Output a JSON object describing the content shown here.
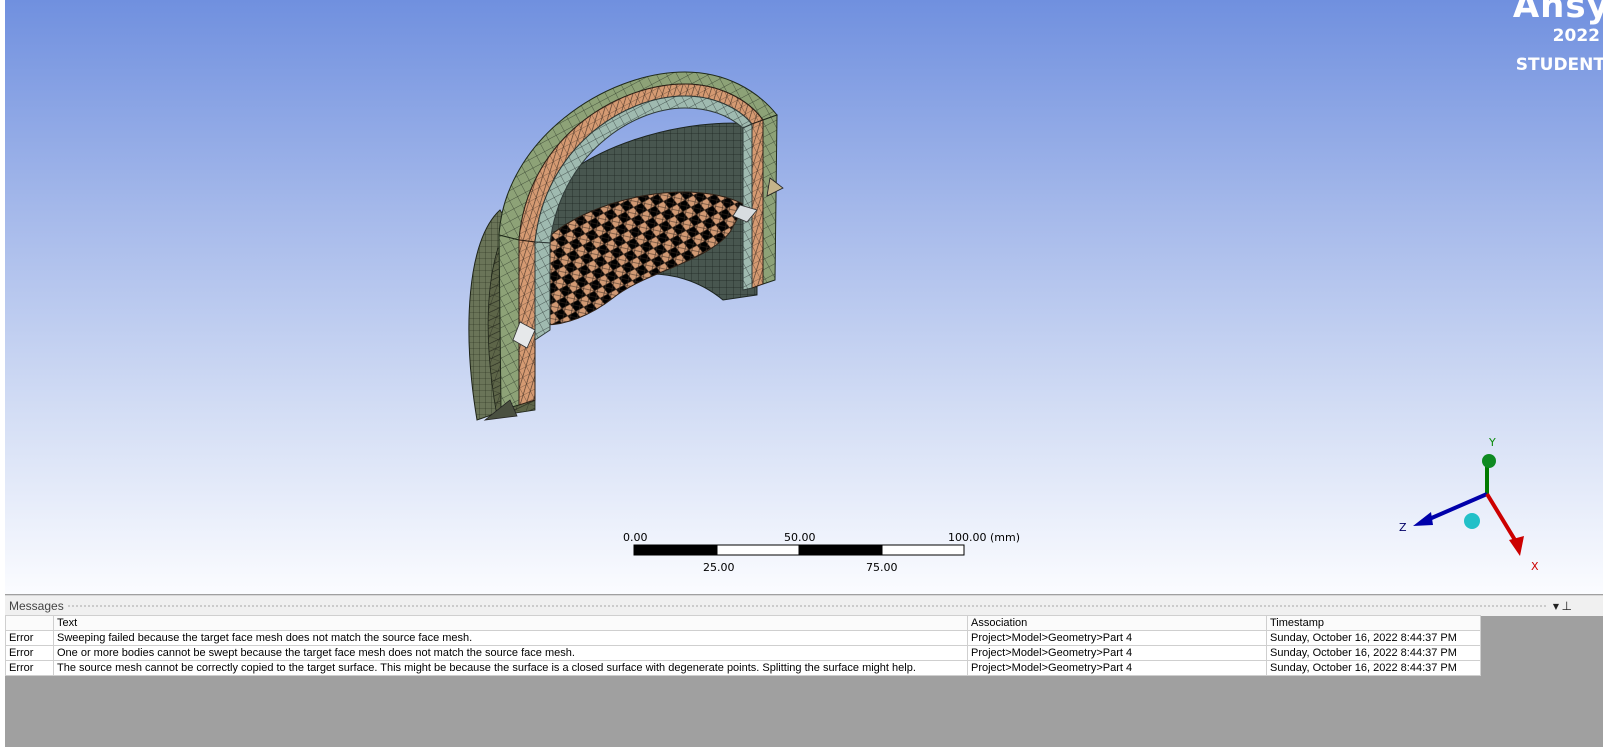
{
  "watermark": {
    "brand": "Ansys",
    "year": "2022",
    "edition": "STUDENT"
  },
  "scale_bar": {
    "labels_top": [
      "0.00",
      "50.00",
      "100.00 (mm)"
    ],
    "labels_bottom": [
      "25.00",
      "75.00"
    ]
  },
  "triad": {
    "x_label": "X",
    "y_label": "Y",
    "z_label": "Z"
  },
  "colors": {
    "background_top": "#7090df",
    "background_bottom": "#fbfcff",
    "mesh_green": "#8da277",
    "mesh_orange": "#d59a72",
    "mesh_cyan": "#9fbab0",
    "mesh_dark": "#4a5a52",
    "axis_x": "#cc0000",
    "axis_y": "#007a00",
    "axis_z": "#0000aa",
    "triad_ball": "#22c0c8"
  },
  "messages": {
    "title": "Messages",
    "columns": [
      "",
      "Text",
      "Association",
      "Timestamp"
    ],
    "rows": [
      {
        "type": "Error",
        "text": "Sweeping failed because the target face mesh does not match the source face mesh.",
        "association": "Project>Model>Geometry>Part 4",
        "timestamp": "Sunday, October 16, 2022 8:44:37 PM"
      },
      {
        "type": "Error",
        "text": "One or more bodies cannot be swept because the target face mesh does not match the source face mesh.",
        "association": "Project>Model>Geometry>Part 4",
        "timestamp": "Sunday, October 16, 2022 8:44:37 PM"
      },
      {
        "type": "Error",
        "text": "The source mesh cannot be correctly copied to the target surface. This might be because the surface is a closed surface with degenerate points. Splitting the surface might help.",
        "association": "Project>Model>Geometry>Part 4",
        "timestamp": "Sunday, October 16, 2022 8:44:37 PM"
      }
    ]
  }
}
